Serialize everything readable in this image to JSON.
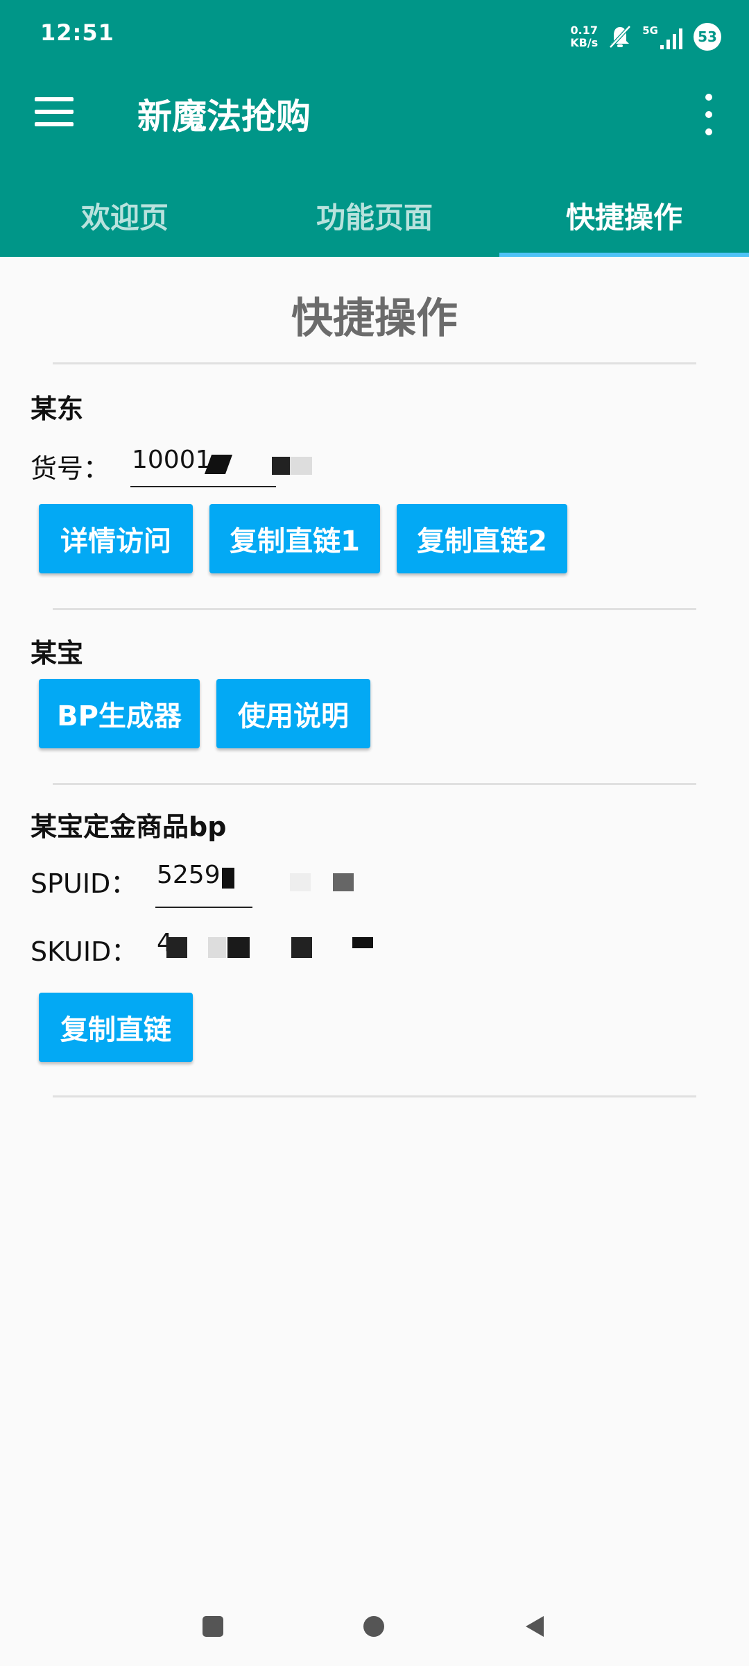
{
  "status_bar": {
    "time": "12:51",
    "net_speed_value": "0.17",
    "net_speed_unit": "KB/s",
    "signal_label": "5G",
    "battery": "53",
    "icons": [
      "mute-icon",
      "signal-icon"
    ]
  },
  "toolbar": {
    "title": "新魔法抢购",
    "menu_icon": "hamburger-icon",
    "overflow_icon": "more-vert-icon"
  },
  "tabs": [
    {
      "label": "欢迎页",
      "active": false
    },
    {
      "label": "功能页面",
      "active": false
    },
    {
      "label": "快捷操作",
      "active": true
    }
  ],
  "page": {
    "heading": "快捷操作"
  },
  "section_jd": {
    "title": "某东",
    "item_no_label": "货号：",
    "item_no_value": "10001",
    "buttons": [
      "详情访问",
      "复制直链1",
      "复制直链2"
    ]
  },
  "section_tb": {
    "title": "某宝",
    "buttons": [
      "BP生成器",
      "使用说明"
    ]
  },
  "section_deposit": {
    "title": "某宝定金商品bp",
    "spuid_label": "SPUID：",
    "spuid_value": "5259",
    "skuid_label": "SKUID：",
    "skuid_value": "4",
    "button": "复制直链"
  },
  "colors": {
    "primary": "#009688",
    "accent_button": "#03a9f4",
    "tab_indicator": "#4fc3f7",
    "background": "#fafafa"
  },
  "nav_bar": {
    "icons": [
      "recent-apps-icon",
      "home-icon",
      "back-icon"
    ]
  }
}
